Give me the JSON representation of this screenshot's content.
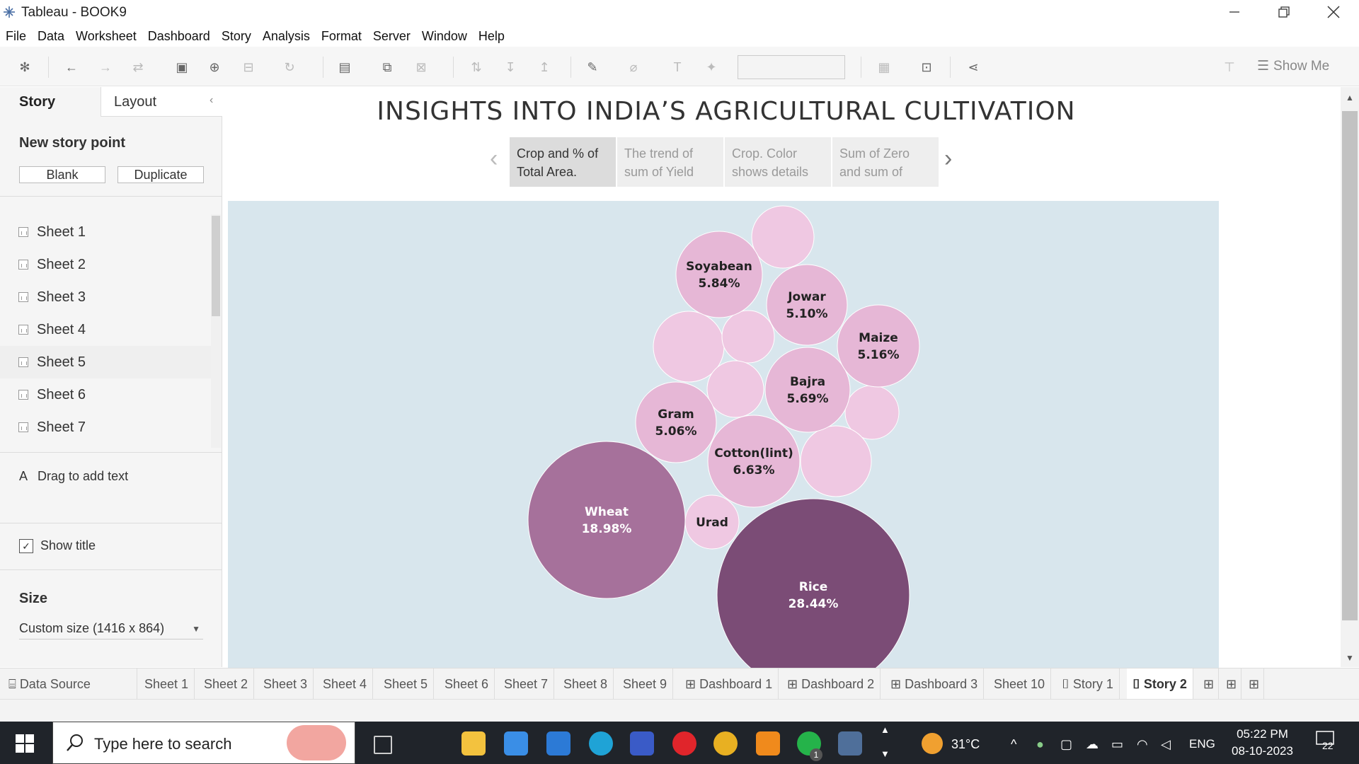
{
  "window": {
    "title": "Tableau - BOOK9"
  },
  "menu": [
    "File",
    "Data",
    "Worksheet",
    "Dashboard",
    "Story",
    "Analysis",
    "Format",
    "Server",
    "Window",
    "Help"
  ],
  "toolbar": {
    "show_me": "Show Me"
  },
  "left_panel": {
    "tabs": [
      "Story",
      "Layout"
    ],
    "new_story_point": "New story point",
    "blank_button": "Blank",
    "duplicate_button": "Duplicate",
    "sheets": [
      "Sheet 1",
      "Sheet 2",
      "Sheet 3",
      "Sheet 4",
      "Sheet 5",
      "Sheet 6",
      "Sheet 7"
    ],
    "drag_text": "Drag to add text",
    "show_title": "Show title",
    "size_header": "Size",
    "size_value": "Custom size (1416 x 864)"
  },
  "story": {
    "title": "INSIGHTS INTO INDIA’S AGRICULTURAL CULTIVATION",
    "points": [
      {
        "text": "Crop and % of Total Area.",
        "active": true
      },
      {
        "text": "The trend of sum of Yield",
        "active": false
      },
      {
        "text": "Crop.  Color shows details",
        "active": false
      },
      {
        "text": "Sum of Zero and sum of",
        "active": false
      }
    ]
  },
  "chart_data": {
    "type": "packed-bubble",
    "measure": "% of Total Area",
    "bubbles": [
      {
        "crop": "Rice",
        "value": "28.44%",
        "v": 28.44
      },
      {
        "crop": "Wheat",
        "value": "18.98%",
        "v": 18.98
      },
      {
        "crop": "Cotton(lint)",
        "value": "6.63%",
        "v": 6.63
      },
      {
        "crop": "Soyabean",
        "value": "5.84%",
        "v": 5.84
      },
      {
        "crop": "Bajra",
        "value": "5.69%",
        "v": 5.69
      },
      {
        "crop": "Maize",
        "value": "5.16%",
        "v": 5.16
      },
      {
        "crop": "Jowar",
        "value": "5.10%",
        "v": 5.1
      },
      {
        "crop": "Gram",
        "value": "5.06%",
        "v": 5.06
      },
      {
        "crop": "Urad",
        "value": "",
        "v": 2.0
      }
    ],
    "colors": {
      "low": "#efc8e2",
      "mid": "#e6b7d6",
      "high_wheat": "#a6719b",
      "high_rice": "#7b4c76",
      "background": "#d8e6ed"
    }
  },
  "sheet_tabs": [
    "Data Source",
    "Sheet 1",
    "Sheet 2",
    "Sheet 3",
    "Sheet 4",
    "Sheet 5",
    "Sheet 6",
    "Sheet 7",
    "Sheet 8",
    "Sheet 9",
    "Dashboard 1",
    "Dashboard 2",
    "Dashboard 3",
    "Sheet 10",
    "Story 1",
    "Story 2"
  ],
  "taskbar": {
    "search_placeholder": "Type here to search",
    "weather": "31°C",
    "language": "ENG",
    "time": "05:22 PM",
    "date": "08-10-2023",
    "notifications": "22",
    "whatsapp_badge": "1"
  }
}
